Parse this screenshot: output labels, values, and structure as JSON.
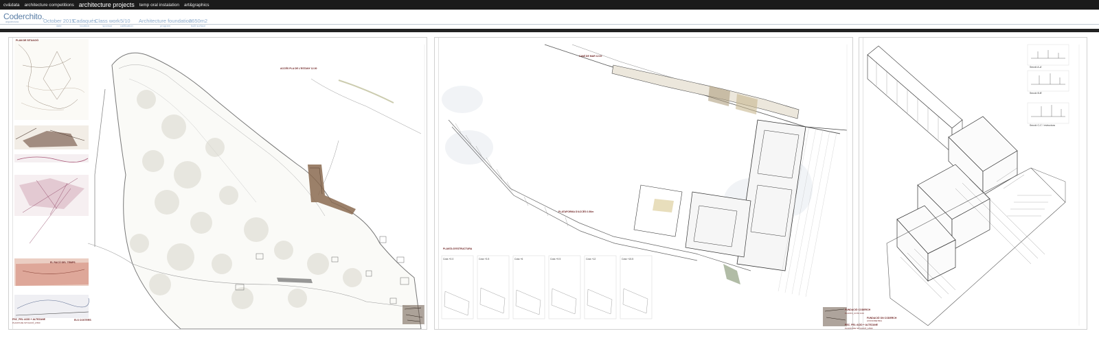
{
  "nav": {
    "items": [
      {
        "label": "cv&data",
        "active": false
      },
      {
        "label": "architecture competitions",
        "active": false
      },
      {
        "label": "architecture projects",
        "active": true
      },
      {
        "label": "temp oral instalation",
        "active": false
      },
      {
        "label": "art&graphics",
        "active": false
      }
    ]
  },
  "header": {
    "logo": "Coderchito.",
    "logo_sub": "arquitectura",
    "meta": [
      {
        "value": "October 2015",
        "label": "date"
      },
      {
        "value": "Cadaqués",
        "label": "location"
      },
      {
        "value": "Class work",
        "label": "sponsor"
      },
      {
        "value": "5/10",
        "label": "calification"
      },
      {
        "value": "Architecture foundation",
        "label": "program"
      },
      {
        "value": "2650m2",
        "label": "built surface"
      }
    ]
  },
  "sheet1": {
    "label_top": "PLAN DE SITUACIÓ",
    "label_access": "ACCÉS PLA DE L'ESTANY 12.00",
    "label_sketch": "EL RACÓ DEL TEMPS",
    "label_sketch2": "ELS COSTERS",
    "footer_title": "PSC_PEL·ACID + ALTEZANE",
    "footer_sub": "PLANTA DE SITUACIÓ_1/500"
  },
  "sheet2": {
    "label_road": "CAMÍ DE MAR 12.00",
    "label_path": "PLATAFORMA D'ACCÉS 0.50m",
    "label_plan": "PLANTA D'ESTRUCTURA",
    "thumbs": [
      "Cota +0.0",
      "Cota +3.5",
      "Cota +6",
      "Cota +9.5",
      "Cota +12",
      "Cota +15.5"
    ],
    "footer_title": "FUNDACIÓ CODERCH",
    "footer_sub": "PLANTA_COTA 0.00"
  },
  "sheet3": {
    "thumb_labels": [
      "Secció A-A'",
      "Secció B-B'",
      "Secció C-C' / estructura"
    ],
    "footer_title": "FUNDACIÓ ON CODERCH",
    "footer_sub": "AXONOMETRIA",
    "footer_title2": "PSC_PEL·ACID + ALTEZANE",
    "footer_sub2": "PLANTA DE SITUACIÓ_1/500"
  }
}
